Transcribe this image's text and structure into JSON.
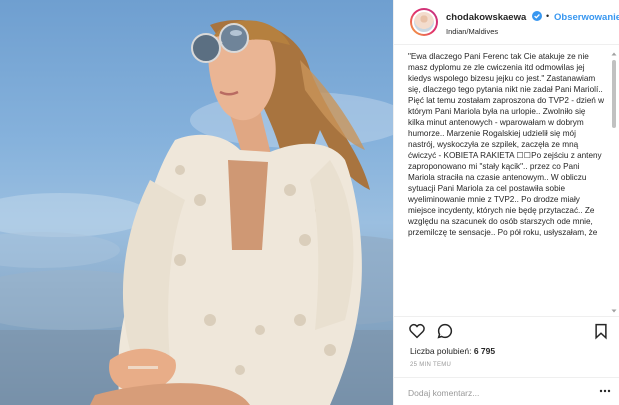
{
  "post": {
    "username": "chodakowskaewa",
    "separator": "•",
    "follow_label": "Obserwowanie",
    "location": "Indian/Maldives"
  },
  "caption": {
    "text": "\"Ewa dlaczego Pani Ferenc tak Cie atakuje ze nie masz dyplomu ze zle cwiczenia itd odmowilas jej kiedys wspolego bizesu jejku co jest.\" Zastanawiam się, dlaczego tego pytania nikt nie zadał Pani Mariolí.. Pięć lat temu zostałam zaproszona do TVP2 - dzień w którym Pani Mariola była na urlopie.. Zwolniło się kilka minut antenowych - wparowałam w dobrym humorze.. Marzenie Rogalskiej udzielił się mój nastrój, wyskoczyła ze szpilek, zaczęła ze mną ćwiczyć - KOBIETA RAKIETA ☐☐Po zejściu z anteny zaproponowano mi \"stały kącik\".. przez co Pani Mariola straciła na czasie antenowym.. W obliczu sytuacji Pani Mariola za cel postawiła sobie wyeliminowanie mnie z TVP2.. Po drodze miały miejsce incydenty, których nie będę przytaczać.. Ze względu na szacunek do osób starszych ode mnie, przemilczę te sensacje.. Po pół roku, usłyszałam, że"
  },
  "engagement": {
    "likes_label": "Liczba polubień:",
    "likes_count": "6 795",
    "time": "25 MIN TEMU"
  },
  "comment": {
    "placeholder": "Dodaj komentarz..."
  },
  "icons": {
    "verified": "verified-badge-icon",
    "like": "heart-icon",
    "comment": "comment-bubble-icon",
    "save": "bookmark-icon",
    "more": "more-options-icon"
  },
  "colors": {
    "link": "#3897f0",
    "verified": "#3897f0",
    "text": "#262626",
    "muted": "#999999"
  }
}
